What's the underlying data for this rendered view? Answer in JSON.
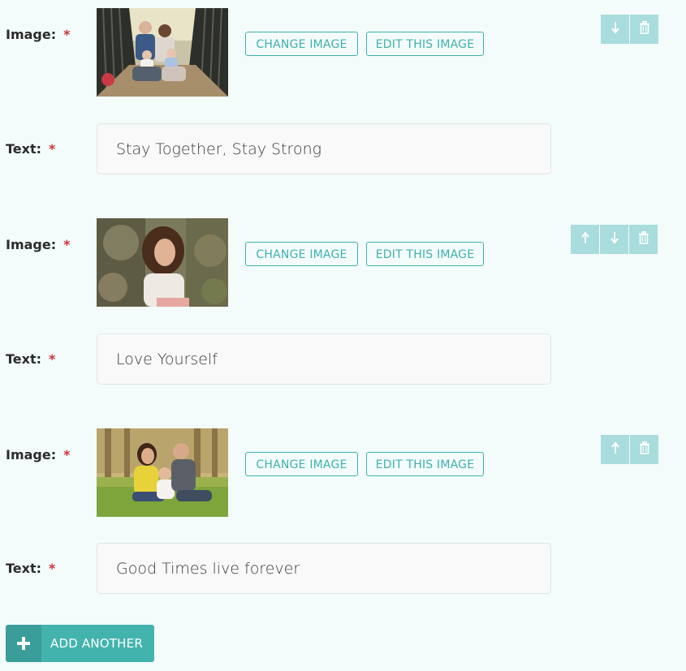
{
  "colors": {
    "background": "#f3fcfb",
    "accent": "#3fb0ad",
    "control_bg": "#a9dcdc",
    "required": "#d0333a",
    "add_button": "#43b3ae"
  },
  "labels": {
    "image": "Image:",
    "text": "Text:",
    "required_marker": "*"
  },
  "items": [
    {
      "image_alt": "family photo on a bridge",
      "change_image": "CHANGE IMAGE",
      "edit_image": "EDIT THIS IMAGE",
      "controls": [
        "arrow-down-icon",
        "trash-icon"
      ],
      "text_value": "Stay Together, Stay Strong"
    },
    {
      "image_alt": "woman smiling in garden",
      "change_image": "CHANGE IMAGE",
      "edit_image": "EDIT THIS IMAGE",
      "controls": [
        "arrow-up-icon",
        "arrow-down-icon",
        "trash-icon"
      ],
      "text_value": "Love Yourself"
    },
    {
      "image_alt": "family sitting on grass",
      "change_image": "CHANGE IMAGE",
      "edit_image": "EDIT THIS IMAGE",
      "controls": [
        "arrow-up-icon",
        "trash-icon"
      ],
      "text_value": "Good Times live forever"
    }
  ],
  "add_button": {
    "icon": "plus-icon",
    "label": "ADD ANOTHER"
  }
}
